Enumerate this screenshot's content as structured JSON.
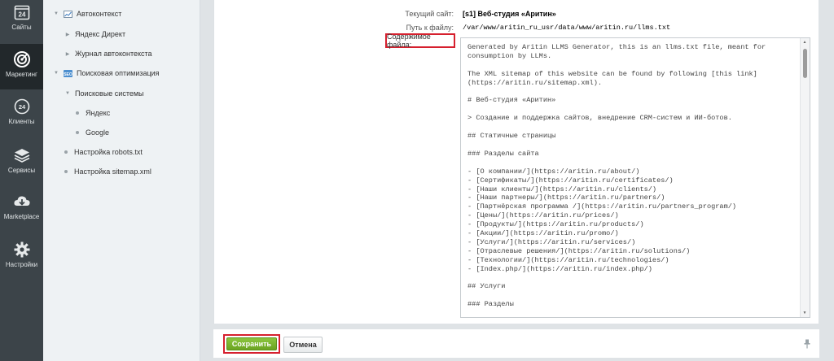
{
  "left_bar": {
    "items": [
      {
        "label": "Сайты",
        "icon": "sites-calendar-icon"
      },
      {
        "label": "Маркетинг",
        "icon": "target-icon"
      },
      {
        "label": "Клиенты",
        "icon": "clients-24-icon"
      },
      {
        "label": "Сервисы",
        "icon": "layers-icon"
      },
      {
        "label": "Marketplace",
        "icon": "cloud-download-icon"
      },
      {
        "label": "Настройки",
        "icon": "gear-icon"
      }
    ]
  },
  "tree": {
    "items": [
      {
        "label": "Автоконтекст"
      },
      {
        "label": "Яндекс Директ"
      },
      {
        "label": "Журнал автоконтекста"
      },
      {
        "label": "Поисковая оптимизация"
      },
      {
        "label": "Поисковые системы"
      },
      {
        "label": "Яндекс"
      },
      {
        "label": "Google"
      },
      {
        "label": "Настройка robots.txt"
      },
      {
        "label": "Настройка sitemap.xml"
      }
    ]
  },
  "form": {
    "site_label": "Текущий сайт:",
    "site_value": "[s1] Веб-студия «Аритин»",
    "path_label": "Путь к файлу:",
    "path_value": "/var/www/aritin_ru_usr/data/www/aritin.ru/llms.txt",
    "content_label": "Содержимое файла:",
    "content_value": "Generated by Aritin LLMS Generator, this is an llms.txt file, meant for\nconsumption by LLMs.\n\nThe XML sitemap of this website can be found by following [this link]\n(https://aritin.ru/sitemap.xml).\n\n# Веб-студия «Аритин»\n\n> Создание и поддержка сайтов, внедрение CRM-систем и ИИ-ботов.\n\n## Статичные страницы\n\n### Разделы сайта\n\n- [О компании/](https://aritin.ru/about/)\n- [Сертификаты/](https://aritin.ru/certificates/)\n- [Наши клиенты/](https://aritin.ru/clients/)\n- [Наши партнеры/](https://aritin.ru/partners/)\n- [Партнёрская программа /](https://aritin.ru/partners_program/)\n- [Цены/](https://aritin.ru/prices/)\n- [Продукты/](https://aritin.ru/products/)\n- [Акции/](https://aritin.ru/promo/)\n- [Услуги/](https://aritin.ru/services/)\n- [Отраслевые решения/](https://aritin.ru/solutions/)\n- [Технологии/](https://aritin.ru/technologies/)\n- [Index.php/](https://aritin.ru/index.php/)\n\n## Услуги\n\n### Разделы\n\n- [Создание сайтов](https://aritin.ru/services/sozdanie-saytov/)"
  },
  "buttons": {
    "save_label": "Сохранить",
    "cancel_label": "Отмена"
  },
  "colors": {
    "highlight": "#d6202e",
    "save_green": "#7bb52e",
    "sidebar_dark": "#3c4449"
  }
}
